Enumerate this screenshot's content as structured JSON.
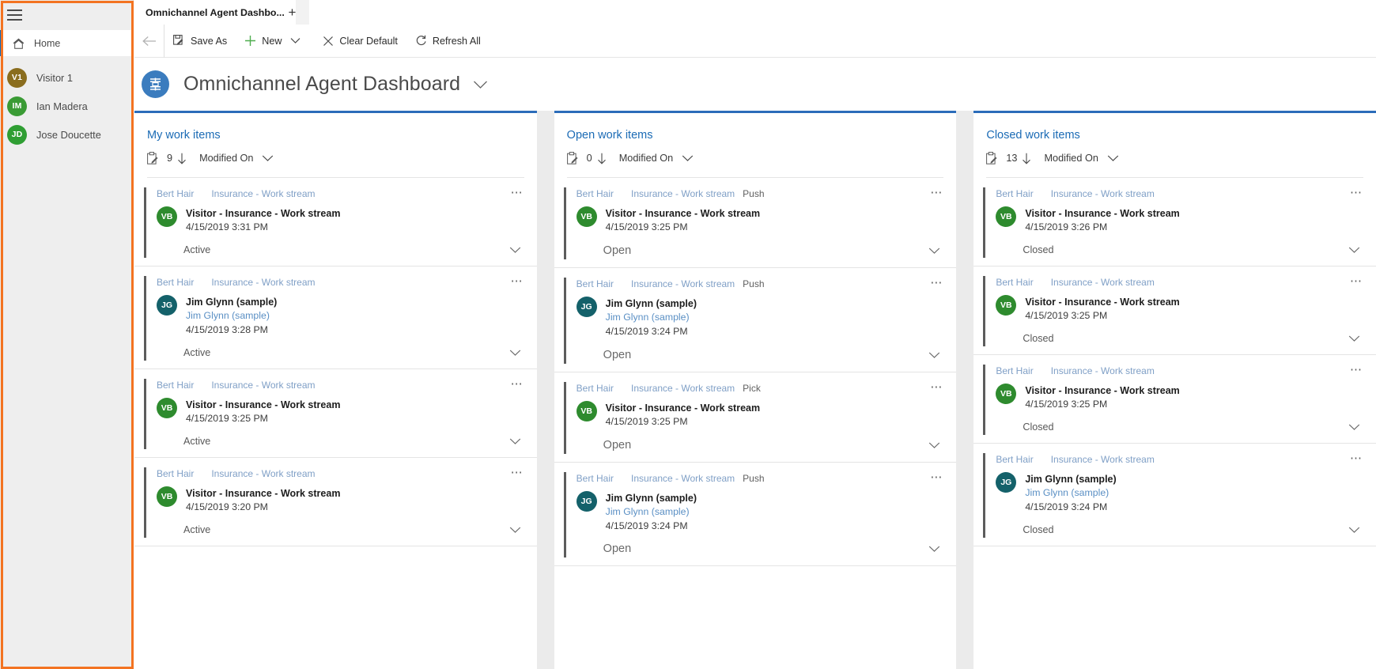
{
  "sidebar": {
    "menu_icon": "hamburger-icon",
    "home": {
      "label": "Home",
      "icon": "home-icon"
    },
    "agents": [
      {
        "initials": "V1",
        "name": "Visitor 1",
        "color": "#8a6d1e"
      },
      {
        "initials": "IM",
        "name": "Ian Madera",
        "color": "#3a9b35"
      },
      {
        "initials": "JD",
        "name": "Jose Doucette",
        "color": "#2f9e33"
      }
    ]
  },
  "tabstrip": {
    "active_tab": "Omnichannel Agent Dashbo...",
    "new_tab": "+"
  },
  "commandbar": {
    "back": "back-arrow-icon",
    "save_as": "Save As",
    "new": "New",
    "clear_default": "Clear Default",
    "refresh_all": "Refresh All"
  },
  "pageheader": {
    "title": "Omnichannel Agent Dashboard",
    "icon": "omnichannel-icon",
    "caret": "chevron-down-icon"
  },
  "columns": [
    {
      "title": "My work items",
      "count": "9",
      "sort_field": "Modified On",
      "cards": [
        {
          "owner": "Bert Hair",
          "stream": "Insurance - Work stream",
          "mode": "",
          "initials": "VB",
          "avatar_color": "#2e8b2e",
          "primary": "Visitor - Insurance - Work stream",
          "secondary": "",
          "time": "4/15/2019 3:31 PM",
          "status": "Active"
        },
        {
          "owner": "Bert Hair",
          "stream": "Insurance - Work stream",
          "mode": "",
          "initials": "JG",
          "avatar_color": "#14616a",
          "primary": "Jim Glynn (sample)",
          "secondary": "Jim Glynn (sample)",
          "time": "4/15/2019 3:28 PM",
          "status": "Active"
        },
        {
          "owner": "Bert Hair",
          "stream": "Insurance - Work stream",
          "mode": "",
          "initials": "VB",
          "avatar_color": "#2e8b2e",
          "primary": "Visitor - Insurance - Work stream",
          "secondary": "",
          "time": "4/15/2019 3:25 PM",
          "status": "Active"
        },
        {
          "owner": "Bert Hair",
          "stream": "Insurance - Work stream",
          "mode": "",
          "initials": "VB",
          "avatar_color": "#2e8b2e",
          "primary": "Visitor - Insurance - Work stream",
          "secondary": "",
          "time": "4/15/2019 3:20 PM",
          "status": "Active"
        }
      ]
    },
    {
      "title": "Open work items",
      "count": "0",
      "sort_field": "Modified On",
      "cards": [
        {
          "owner": "Bert Hair",
          "stream": "Insurance - Work stream",
          "mode": "Push",
          "initials": "VB",
          "avatar_color": "#2e8b2e",
          "primary": "Visitor - Insurance - Work stream",
          "secondary": "",
          "time": "4/15/2019 3:25 PM",
          "status": "Open"
        },
        {
          "owner": "Bert Hair",
          "stream": "Insurance - Work stream",
          "mode": "Push",
          "initials": "JG",
          "avatar_color": "#14616a",
          "primary": "Jim Glynn (sample)",
          "secondary": "Jim Glynn (sample)",
          "time": "4/15/2019 3:24 PM",
          "status": "Open"
        },
        {
          "owner": "Bert Hair",
          "stream": "Insurance - Work stream",
          "mode": "Pick",
          "initials": "VB",
          "avatar_color": "#2e8b2e",
          "primary": "Visitor - Insurance - Work stream",
          "secondary": "",
          "time": "4/15/2019 3:25 PM",
          "status": "Open"
        },
        {
          "owner": "Bert Hair",
          "stream": "Insurance - Work stream",
          "mode": "Push",
          "initials": "JG",
          "avatar_color": "#14616a",
          "primary": "Jim Glynn (sample)",
          "secondary": "Jim Glynn (sample)",
          "time": "4/15/2019 3:24 PM",
          "status": "Open"
        }
      ]
    },
    {
      "title": "Closed work items",
      "count": "13",
      "sort_field": "Modified On",
      "cards": [
        {
          "owner": "Bert Hair",
          "stream": "Insurance - Work stream",
          "mode": "",
          "initials": "VB",
          "avatar_color": "#2e8b2e",
          "primary": "Visitor - Insurance - Work stream",
          "secondary": "",
          "time": "4/15/2019 3:26 PM",
          "status": "Closed"
        },
        {
          "owner": "Bert Hair",
          "stream": "Insurance - Work stream",
          "mode": "",
          "initials": "VB",
          "avatar_color": "#2e8b2e",
          "primary": "Visitor - Insurance - Work stream",
          "secondary": "",
          "time": "4/15/2019 3:25 PM",
          "status": "Closed"
        },
        {
          "owner": "Bert Hair",
          "stream": "Insurance - Work stream",
          "mode": "",
          "initials": "VB",
          "avatar_color": "#2e8b2e",
          "primary": "Visitor - Insurance - Work stream",
          "secondary": "",
          "time": "4/15/2019 3:25 PM",
          "status": "Closed"
        },
        {
          "owner": "Bert Hair",
          "stream": "Insurance - Work stream",
          "mode": "",
          "initials": "JG",
          "avatar_color": "#14616a",
          "primary": "Jim Glynn (sample)",
          "secondary": "Jim Glynn (sample)",
          "time": "4/15/2019 3:24 PM",
          "status": "Closed"
        }
      ]
    }
  ],
  "colors": {
    "accent_blue": "#2b6cb9",
    "title_blue": "#1b6bb5",
    "highlight_orange": "#f37321",
    "link_blue": "#7f9fc6"
  }
}
